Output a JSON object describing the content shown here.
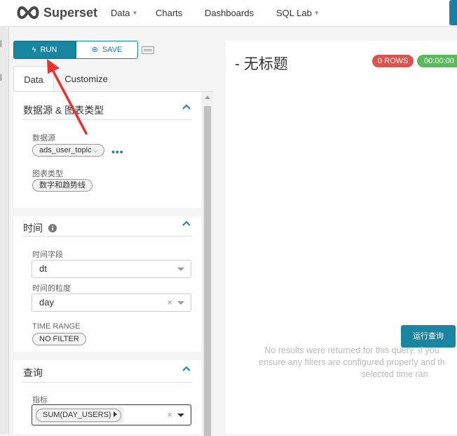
{
  "navbar": {
    "brand": "Superset",
    "items": [
      {
        "label": "Data",
        "has_caret": true
      },
      {
        "label": "Charts",
        "has_caret": false
      },
      {
        "label": "Dashboards",
        "has_caret": false
      },
      {
        "label": "SQL Lab",
        "has_caret": true
      }
    ]
  },
  "toolbar": {
    "run_label": "RUN",
    "save_label": "SAVE"
  },
  "tabs": [
    {
      "label": "Data",
      "active": true
    },
    {
      "label": "Customize",
      "active": false
    }
  ],
  "sections": {
    "datasource": {
      "title": "数据源 & 图表类型",
      "datasource_label": "数据源",
      "datasource_value": "ads_user_topic",
      "more_label": "•••",
      "viz_type_label": "图表类型",
      "viz_type_value": "数字和趋势线"
    },
    "time": {
      "title": "时间",
      "time_column_label": "时间字段",
      "time_column_value": "dt",
      "time_grain_label": "时间的粒度",
      "time_grain_value": "day",
      "time_range_label": "TIME RANGE",
      "time_range_value": "NO FILTER"
    },
    "query": {
      "title": "查询",
      "metric_label": "指标",
      "metric_value": "SUM(DAY_USERS)"
    }
  },
  "clear_icon_text": "×",
  "main": {
    "chart_title": "- 无标题",
    "rows_badge": "0 ROWS",
    "time_badge": "00:00:00",
    "run_query_label": "运行查询",
    "empty_message_lines": [
      "No results were returned for this query. If you",
      "ensure any filters are configured properly and th",
      "selected time ran"
    ]
  },
  "colors": {
    "primary": "#1a85a0",
    "danger": "#d9534f",
    "success": "#5cb85c",
    "annotation": "#e8322f"
  }
}
